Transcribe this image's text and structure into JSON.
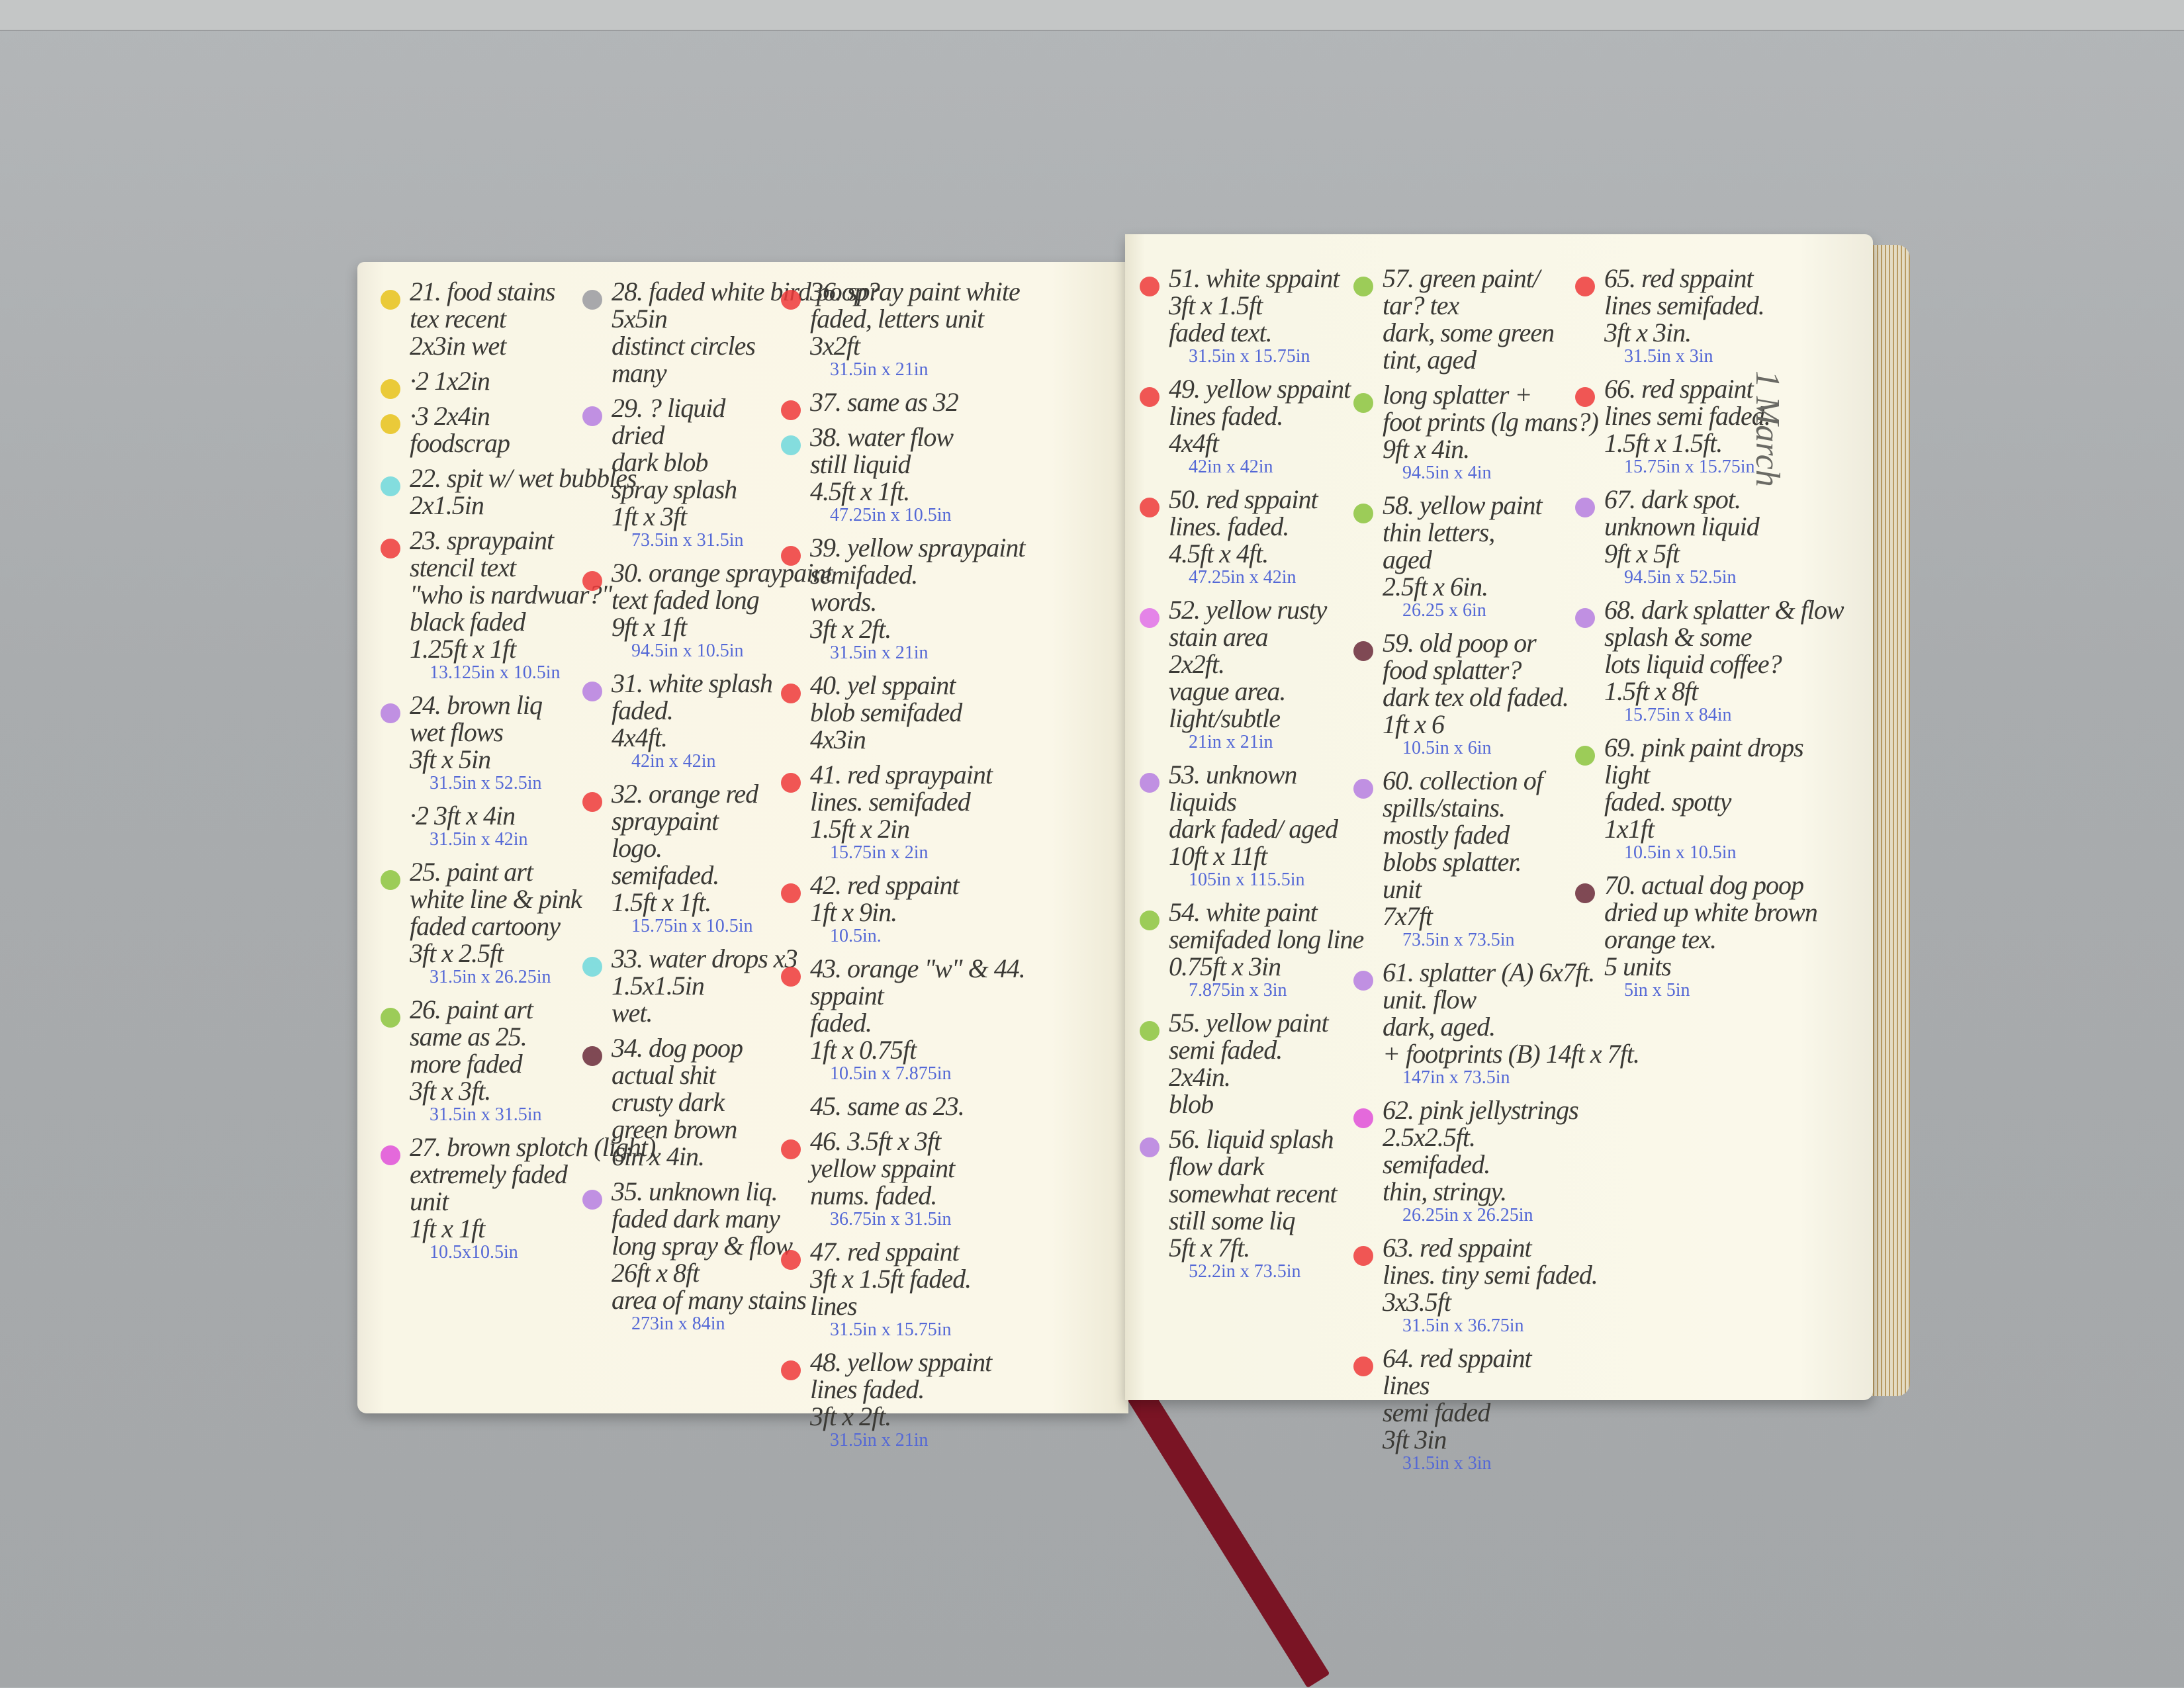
{
  "colors": {
    "yellow": "#e8c21a",
    "red": "#ee3a3a",
    "cyan": "#6fd8dc",
    "purple": "#b67ee0",
    "gray": "#9a9aa0",
    "green": "#8cc43e",
    "brown": "#6a2a3a",
    "magenta": "#e050d8",
    "pink": "#e070e8"
  },
  "margin_note": "1 March",
  "columns": [
    [
      {
        "dot": "yellow",
        "lines": [
          "21. food stains",
          "tex recent",
          "2x3in wet"
        ]
      },
      {
        "dot": "yellow",
        "lines": [
          "·2 1x2in"
        ]
      },
      {
        "dot": "yellow",
        "lines": [
          "·3 2x4in",
          "foodscrap"
        ]
      },
      {
        "dot": "cyan",
        "lines": [
          "22. spit w/ wet bubbles",
          "2x1.5in"
        ]
      },
      {
        "dot": "red",
        "lines": [
          "23. spraypaint",
          "stencil text",
          "\"who is nardwuar?\"",
          "black faded",
          "1.25ft x 1ft"
        ],
        "blue": "13.125in x 10.5in"
      },
      {
        "dot": "purple",
        "lines": [
          "24. brown liq",
          "wet flows",
          "3ft x 5in"
        ],
        "blue": "31.5in x 52.5in"
      },
      {
        "dot": "",
        "lines": [
          "·2 3ft x 4in"
        ],
        "blue": "31.5in x 42in"
      },
      {
        "dot": "green",
        "lines": [
          "25. paint art",
          "white line & pink",
          "faded cartoony",
          "3ft x 2.5ft"
        ],
        "blue": "31.5in x 26.25in"
      },
      {
        "dot": "green",
        "lines": [
          "26. paint art",
          "same as 25.",
          "more faded",
          "3ft x 3ft."
        ],
        "blue": "31.5in x 31.5in"
      },
      {
        "dot": "magenta",
        "lines": [
          "27. brown splotch (light)",
          "extremely faded",
          "unit",
          "1ft x 1ft"
        ],
        "blue": "10.5x10.5in"
      }
    ],
    [
      {
        "dot": "gray",
        "lines": [
          "28. faded white bird poop?",
          "5x5in",
          "distinct circles",
          "many"
        ]
      },
      {
        "dot": "purple",
        "lines": [
          "29. ? liquid",
          "dried",
          "dark blob",
          "spray splash",
          "1ft x 3ft"
        ],
        "blue": "73.5in x 31.5in"
      },
      {
        "dot": "red",
        "lines": [
          "30. orange spraypaint",
          "text faded long",
          "9ft x 1ft"
        ],
        "blue": "94.5in x 10.5in"
      },
      {
        "dot": "purple",
        "lines": [
          "31. white splash",
          "faded.",
          "4x4ft."
        ],
        "blue": "42in x 42in"
      },
      {
        "dot": "red",
        "lines": [
          "32. orange red",
          "spraypaint",
          "logo.",
          "semifaded.",
          "1.5ft x 1ft."
        ],
        "blue": "15.75in x 10.5in"
      },
      {
        "dot": "cyan",
        "lines": [
          "33. water drops x3",
          "1.5x1.5in",
          "wet."
        ]
      },
      {
        "dot": "brown",
        "lines": [
          "34. dog poop",
          "actual shit",
          "crusty dark",
          "green brown",
          "6in x 4in."
        ]
      },
      {
        "dot": "purple",
        "lines": [
          "35. unknown liq.",
          "faded dark many",
          "long spray & flow",
          "26ft x 8ft",
          "area of many stains"
        ],
        "blue": "273in x 84in"
      }
    ],
    [
      {
        "dot": "red",
        "lines": [
          "36. spray paint white",
          "faded, letters unit",
          "3x2ft"
        ],
        "blue": "31.5in x 21in"
      },
      {
        "dot": "red",
        "lines": [
          "37. same as 32"
        ]
      },
      {
        "dot": "cyan",
        "lines": [
          "38. water flow",
          "still liquid",
          "4.5ft x 1ft."
        ],
        "blue": "47.25in x 10.5in"
      },
      {
        "dot": "red",
        "lines": [
          "39. yellow spraypaint",
          "semifaded.",
          "words.",
          "3ft x 2ft."
        ],
        "blue": "31.5in x 21in"
      },
      {
        "dot": "red",
        "lines": [
          "40. yel sppaint",
          "blob semifaded",
          "4x3in"
        ]
      },
      {
        "dot": "red",
        "lines": [
          "41. red spraypaint",
          "lines. semifaded",
          "1.5ft x 2in"
        ],
        "blue": "15.75in x 2in"
      },
      {
        "dot": "red",
        "lines": [
          "42. red sppaint",
          "1ft x 9in."
        ],
        "blue": "10.5in."
      },
      {
        "dot": "red",
        "lines": [
          "43. orange \"w\" & 44.",
          "sppaint",
          "faded.",
          "1ft x 0.75ft"
        ],
        "blue": "10.5in x 7.875in"
      },
      {
        "dot": "",
        "lines": [
          "45. same as 23."
        ]
      },
      {
        "dot": "red",
        "lines": [
          "46. 3.5ft x 3ft",
          "yellow sppaint",
          "nums. faded."
        ],
        "blue": "36.75in x 31.5in"
      },
      {
        "dot": "red",
        "lines": [
          "47. red sppaint",
          "3ft x 1.5ft faded.",
          "lines"
        ],
        "blue": "31.5in x 15.75in"
      },
      {
        "dot": "red",
        "lines": [
          "48. yellow sppaint",
          "lines faded.",
          "3ft x 2ft."
        ],
        "blue": "31.5in x 21in"
      }
    ],
    [
      {
        "dot": "red",
        "lines": [
          "51. white sppaint",
          "3ft x 1.5ft",
          "faded text."
        ],
        "blue": "31.5in x 15.75in"
      },
      {
        "dot": "red",
        "lines": [
          "49. yellow sppaint",
          "lines faded.",
          "4x4ft"
        ],
        "blue": "42in x 42in"
      },
      {
        "dot": "red",
        "lines": [
          "50. red sppaint",
          "lines. faded.",
          "4.5ft x 4ft."
        ],
        "blue": "47.25in x 42in"
      },
      {
        "dot": "pink",
        "lines": [
          "52. yellow rusty",
          "stain area",
          "2x2ft.",
          "vague area.",
          "light/subtle"
        ],
        "blue": "21in x 21in"
      },
      {
        "dot": "purple",
        "lines": [
          "53. unknown",
          "liquids",
          "dark faded/ aged",
          "10ft x 11ft"
        ],
        "blue": "105in x 115.5in"
      },
      {
        "dot": "green",
        "lines": [
          "54. white paint",
          "semifaded long line",
          "0.75ft x 3in"
        ],
        "blue": "7.875in x 3in"
      },
      {
        "dot": "green",
        "lines": [
          "55. yellow paint",
          "semi faded.",
          "2x4in.",
          "blob"
        ]
      },
      {
        "dot": "purple",
        "lines": [
          "56. liquid splash",
          "flow dark",
          "somewhat recent",
          "still some liq",
          "5ft x 7ft."
        ],
        "blue": "52.2in x 73.5in"
      }
    ],
    [
      {
        "dot": "green",
        "lines": [
          "57. green paint/",
          "tar? tex",
          "dark, some green",
          "tint, aged"
        ]
      },
      {
        "dot": "green",
        "lines": [
          "long splatter +",
          "foot prints (lg mans?)",
          "9ft x 4in."
        ],
        "blue": "94.5in x 4in"
      },
      {
        "dot": "green",
        "lines": [
          "58. yellow paint",
          "thin letters,",
          "aged",
          "2.5ft x 6in."
        ],
        "blue": "26.25 x 6in"
      },
      {
        "dot": "brown",
        "lines": [
          "59. old poop or",
          "food splatter?",
          "dark tex old faded.",
          "1ft x 6"
        ],
        "blue": "10.5in x 6in"
      },
      {
        "dot": "purple",
        "lines": [
          "60. collection of",
          "spills/stains.",
          "mostly faded",
          "blobs splatter.",
          "unit",
          "7x7ft"
        ],
        "blue": "73.5in x 73.5in"
      },
      {
        "dot": "purple",
        "lines": [
          "61. splatter (A) 6x7ft.",
          "unit. flow",
          "dark, aged.",
          "+ footprints (B) 14ft x 7ft."
        ],
        "blue": "147in x 73.5in"
      },
      {
        "dot": "magenta",
        "lines": [
          "62. pink jellystrings",
          "2.5x2.5ft.",
          "semifaded.",
          "thin, stringy."
        ],
        "blue": "26.25in x 26.25in"
      },
      {
        "dot": "red",
        "lines": [
          "63. red sppaint",
          "lines. tiny semi faded.",
          "3x3.5ft"
        ],
        "blue": "31.5in x 36.75in"
      },
      {
        "dot": "red",
        "lines": [
          "64. red sppaint",
          "lines",
          "semi faded",
          "3ft 3in"
        ],
        "blue": "31.5in x 3in"
      }
    ],
    [
      {
        "dot": "red",
        "lines": [
          "65. red sppaint",
          "lines semifaded.",
          "3ft x 3in."
        ],
        "blue": "31.5in x 3in"
      },
      {
        "dot": "red",
        "lines": [
          "66. red sppaint",
          "lines semi faded.",
          "1.5ft x 1.5ft."
        ],
        "blue": "15.75in x 15.75in"
      },
      {
        "dot": "purple",
        "lines": [
          "67. dark spot.",
          "unknown liquid",
          "9ft x 5ft"
        ],
        "blue": "94.5in x 52.5in"
      },
      {
        "dot": "purple",
        "lines": [
          "68. dark splatter & flow",
          "splash & some",
          "lots liquid coffee?",
          "1.5ft x 8ft"
        ],
        "blue": "15.75in x 84in"
      },
      {
        "dot": "green",
        "lines": [
          "69. pink paint drops",
          "light",
          "faded. spotty",
          "1x1ft"
        ],
        "blue": "10.5in x 10.5in"
      },
      {
        "dot": "brown",
        "lines": [
          "70. actual dog poop",
          "dried up white brown",
          "orange tex.",
          "5 units"
        ],
        "blue": "5in x 5in"
      }
    ]
  ]
}
